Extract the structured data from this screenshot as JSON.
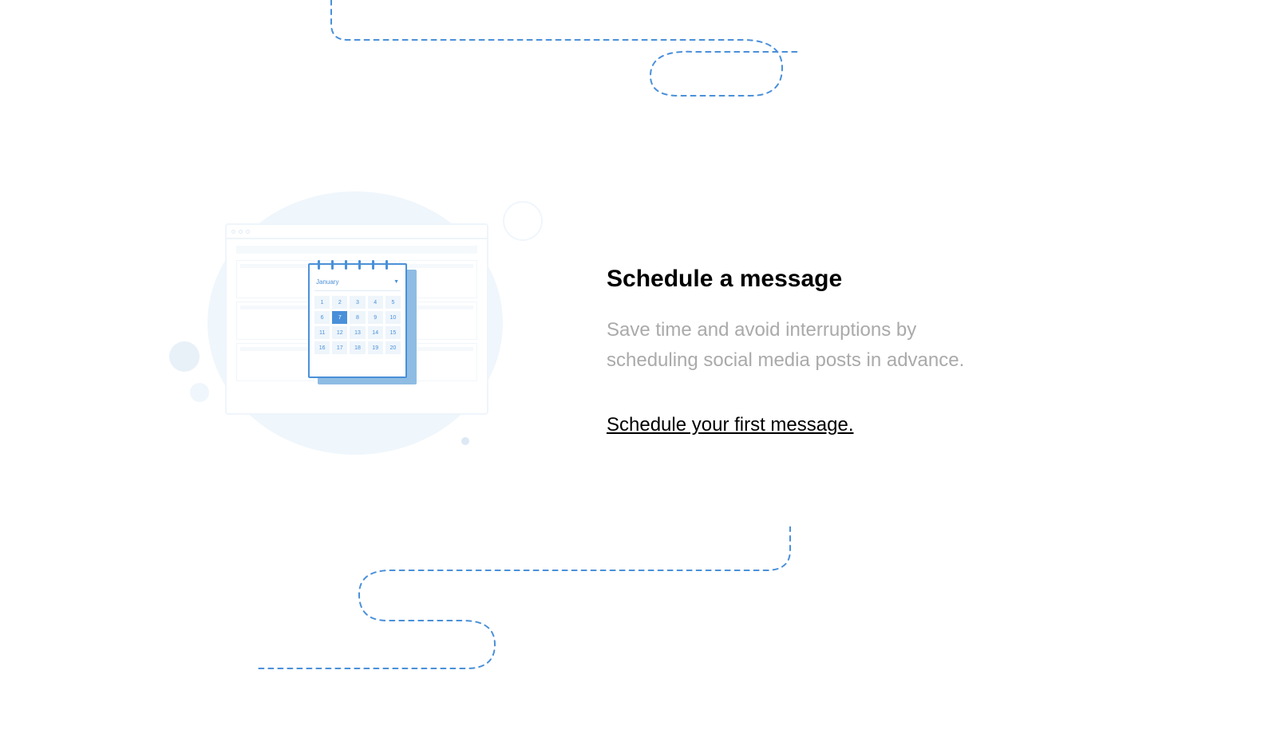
{
  "heading": "Schedule a message",
  "description": "Save time and avoid interruptions by scheduling social media posts in advance.",
  "cta_text": "Schedule your first message.",
  "calendar": {
    "month_label": "January",
    "selected_day": "7",
    "days": [
      "1",
      "2",
      "3",
      "4",
      "5",
      "6",
      "7",
      "8",
      "9",
      "10",
      "11",
      "12",
      "13",
      "14",
      "15",
      "16",
      "17",
      "18",
      "19",
      "20"
    ]
  }
}
